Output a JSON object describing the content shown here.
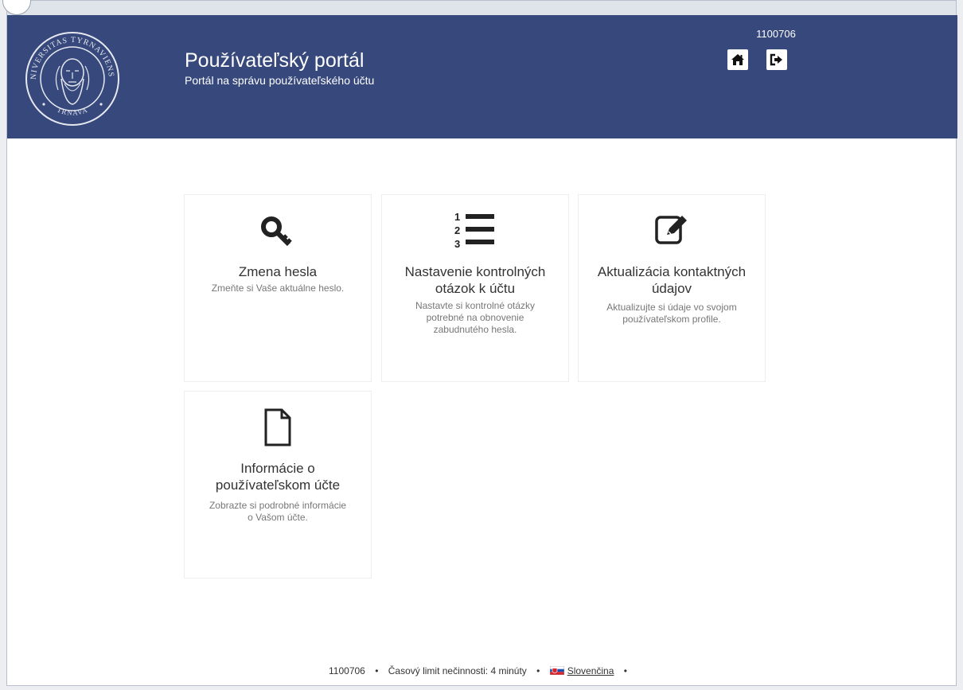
{
  "header": {
    "title": "Používateľský portál",
    "subtitle": "Portál na správu používateľského účtu",
    "user_id": "1100706",
    "seal_text_top": "UNIVERSITAS TYRNAVIENSIS",
    "seal_text_bottom": "TRNAVA",
    "home_icon": "home-icon",
    "logout_icon": "sign-out-icon"
  },
  "tiles": [
    {
      "title": "Zmena hesla",
      "description": "Zmeňte si Vaše aktuálne heslo.",
      "icon": "key-icon"
    },
    {
      "title": "Nastavenie kontrolných otázok k účtu",
      "description": "Nastavte si kontrolné otázky potrebné na obnovenie zabudnutého hesla.",
      "icon": "ordered-list-icon"
    },
    {
      "title": "Aktualizácia kontaktných údajov",
      "description": "Aktualizujte si údaje vo svojom používateľskom profile.",
      "icon": "edit-icon"
    },
    {
      "title": "Informácie o používateľskom účte",
      "description": "Zobrazte si podrobné informácie o Vašom účte.",
      "icon": "file-icon"
    }
  ],
  "footer": {
    "user_id": "1100706",
    "timeout": "Časový limit nečinnosti: 4 minúty",
    "language": "Slovenčina",
    "separator": "•"
  },
  "colors": {
    "header_bg": "#36487c",
    "tile_border": "#eeeeee",
    "text_muted": "#777777"
  }
}
